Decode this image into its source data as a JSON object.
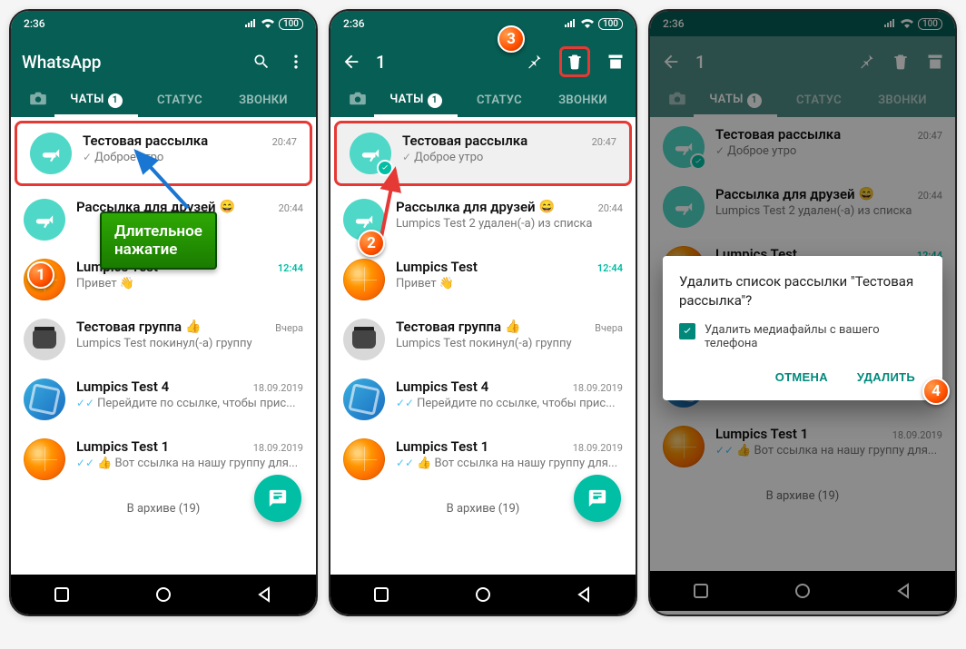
{
  "status_time": "2:36",
  "app_title": "WhatsApp",
  "selection_count": "1",
  "tabs": {
    "chats": "ЧАТЫ",
    "status": "СТАТУС",
    "calls": "ЗВОНКИ",
    "badge": "1"
  },
  "chats": [
    {
      "name": "Тестовая рассылка",
      "msg_prefix": "✓",
      "msg": "Доброе утро",
      "time": "20:47"
    },
    {
      "name": "Рассылка для друзей",
      "emoji": "😄",
      "msg": "Lumpics Test 2 удален(-а) из списка",
      "time": "20:44"
    },
    {
      "name": "Lumpics Test",
      "msg": "Привет 👋",
      "time": "12:44",
      "unread": true
    },
    {
      "name": "Тестовая группа",
      "emoji": "👍",
      "msg": "Lumpics Test покинул(-а) группу",
      "time": "Вчера"
    },
    {
      "name": "Lumpics Test 4",
      "msg_prefix_read": true,
      "msg": "Перейдите по ссылке, чтобы прис...",
      "time": "18.09.2019"
    },
    {
      "name": "Lumpics Test 1",
      "msg_prefix_read": true,
      "msg": "👍 Вот ссылка на нашу группу для...",
      "time": "18.09.2019"
    }
  ],
  "chat1_alt_msg": "Рассылка для друзей",
  "archived": "В архиве (19)",
  "tooltip": "Длительное\nнажатие",
  "tooltip_line1": "Длительное",
  "tooltip_line2": "нажатие",
  "dialog": {
    "title": "Удалить список рассылки \"Тестовая рассылка\"?",
    "checkbox": "Удалить медиафайлы с вашего телефона",
    "cancel": "ОТМЕНА",
    "delete": "УДАЛИТЬ"
  },
  "badges": {
    "b1": "1",
    "b2": "2",
    "b3": "3",
    "b4": "4"
  }
}
